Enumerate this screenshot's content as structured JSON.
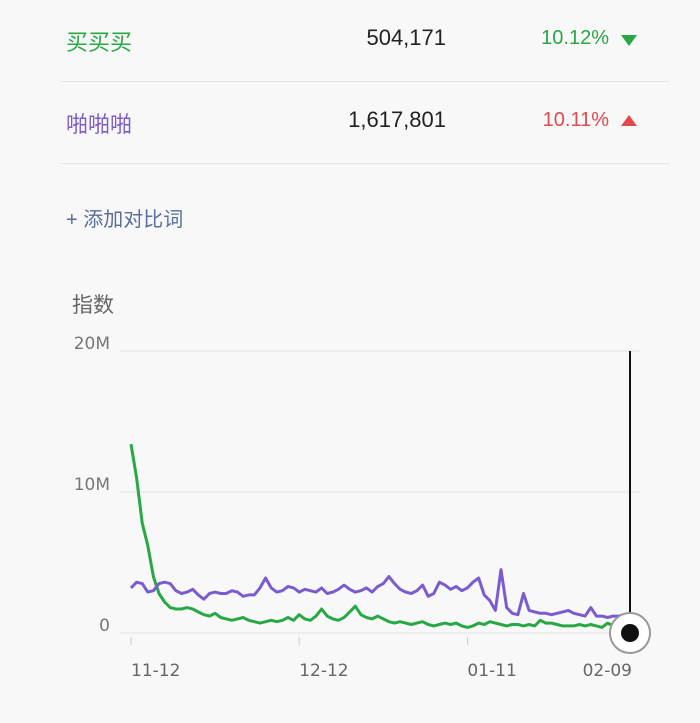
{
  "rows": [
    {
      "word": "买买买",
      "count": "504,171",
      "percent": "10.12%",
      "trend": "down",
      "color": "#27a844",
      "pct_color": "#27a844"
    },
    {
      "word": "啪啪啪",
      "count": "1,617,801",
      "percent": "10.11%",
      "trend": "up",
      "color": "#7b5ccf",
      "pct_color": "#e04b4b"
    }
  ],
  "add_compare_label": "+ 添加对比词",
  "chart_data": {
    "type": "line",
    "ylabel": "指数",
    "ylim": [
      0,
      20000000
    ],
    "yticks": [
      {
        "value": 0,
        "label": "0"
      },
      {
        "value": 10000000,
        "label": "10M"
      },
      {
        "value": 20000000,
        "label": "20M"
      }
    ],
    "xticks": [
      {
        "index": 0,
        "label": "11-12"
      },
      {
        "index": 30,
        "label": "12-12"
      },
      {
        "index": 60,
        "label": "01-11"
      },
      {
        "index": 89,
        "label": "02-09"
      }
    ],
    "grid": true,
    "series": [
      {
        "name": "买买买",
        "color": "#27a844",
        "values": [
          13400000,
          11000000,
          7800000,
          6200000,
          4000000,
          2800000,
          2200000,
          1800000,
          1700000,
          1700000,
          1800000,
          1700000,
          1500000,
          1300000,
          1200000,
          1400000,
          1100000,
          1000000,
          900000,
          1000000,
          1100000,
          900000,
          800000,
          700000,
          800000,
          900000,
          800000,
          900000,
          1100000,
          900000,
          1300000,
          1000000,
          900000,
          1200000,
          1700000,
          1200000,
          1000000,
          900000,
          1100000,
          1500000,
          1900000,
          1300000,
          1100000,
          1000000,
          1200000,
          1000000,
          800000,
          700000,
          800000,
          700000,
          600000,
          700000,
          800000,
          600000,
          500000,
          600000,
          700000,
          600000,
          700000,
          500000,
          400000,
          500000,
          700000,
          600000,
          800000,
          700000,
          600000,
          500000,
          600000,
          600000,
          500000,
          600000,
          500000,
          900000,
          700000,
          700000,
          600000,
          500000,
          500000,
          500000,
          600000,
          500000,
          600000,
          500000,
          400000,
          700000,
          500000,
          500000,
          400000,
          500000
        ]
      },
      {
        "name": "啪啪啪",
        "color": "#7b5ccf",
        "values": [
          3200000,
          3600000,
          3500000,
          2900000,
          3000000,
          3500000,
          3600000,
          3500000,
          3000000,
          2800000,
          2900000,
          3100000,
          2700000,
          2400000,
          2800000,
          2900000,
          2800000,
          2800000,
          3000000,
          2900000,
          2600000,
          2700000,
          2700000,
          3200000,
          3900000,
          3200000,
          2900000,
          3000000,
          3300000,
          3200000,
          2900000,
          3100000,
          3000000,
          2900000,
          3200000,
          2800000,
          2900000,
          3100000,
          3400000,
          3100000,
          2900000,
          3000000,
          3200000,
          2900000,
          3300000,
          3500000,
          4000000,
          3500000,
          3100000,
          2900000,
          2800000,
          3000000,
          3400000,
          2600000,
          2800000,
          3600000,
          3400000,
          3100000,
          3300000,
          3000000,
          3200000,
          3600000,
          3900000,
          2700000,
          2300000,
          1600000,
          4500000,
          1800000,
          1400000,
          1300000,
          2800000,
          1600000,
          1500000,
          1400000,
          1400000,
          1300000,
          1400000,
          1500000,
          1600000,
          1400000,
          1300000,
          1200000,
          1800000,
          1200000,
          1200000,
          1100000,
          1200000,
          1200000,
          1300000,
          1200000
        ]
      }
    ]
  }
}
